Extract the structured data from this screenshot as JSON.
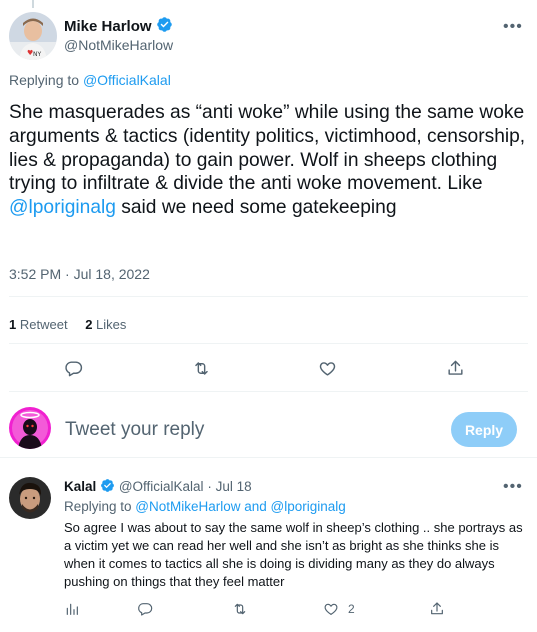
{
  "main_tweet": {
    "author_name": "Mike Harlow",
    "author_handle": "@NotMikeHarlow",
    "replying_to_prefix": "Replying to ",
    "replying_to_handle": "@OfficialKalal",
    "text_part1": "She masquerades as “anti woke” while using the same woke arguments & tactics (identity politics, victimhood, censorship, lies & propaganda) to gain power. Wolf in sheeps clothing trying to infiltrate & divide the anti woke movement. Like ",
    "text_mention": "@lporiginalg",
    "text_part2": " said we need some gatekeeping",
    "timestamp": "3:52 PM · Jul 18, 2022",
    "retweet_count": "1",
    "retweet_label": "Retweet",
    "like_count": "2",
    "like_label": "Likes"
  },
  "composer": {
    "placeholder": "Tweet your reply",
    "reply_button": "Reply"
  },
  "reply_tweet": {
    "author_name": "Kalal",
    "author_handle": "@OfficialKalal",
    "date": "· Jul 18",
    "replying_to_prefix": "Replying to ",
    "replying_to_handles": "@NotMikeHarlow and @lporiginalg",
    "text": "So agree I was about to say the same wolf in sheep’s  clothing .. she portrays as a victim yet we can read her well and she isn’t as bright as she thinks she is when it comes to tactics all she is doing is dividing many as they do always pushing on things that they feel matter",
    "like_count": "2"
  },
  "icons": {
    "verified": "verified-badge-icon",
    "more": "more-icon",
    "reply": "reply-icon",
    "retweet": "retweet-icon",
    "like": "heart-icon",
    "share": "share-icon",
    "analytics": "analytics-icon"
  },
  "colors": {
    "accent": "#1d9bf0",
    "reply_button_disabled": "#8ecdf8",
    "secondary_text": "#536471",
    "divider": "#eff3f4"
  }
}
